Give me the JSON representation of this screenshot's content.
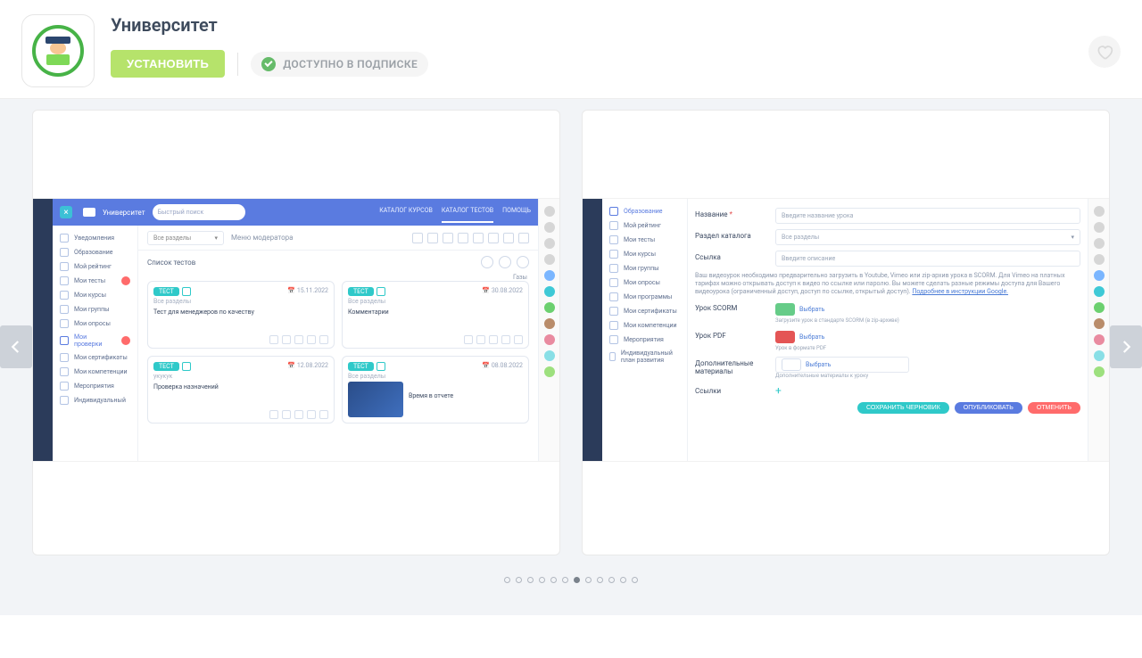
{
  "header": {
    "title": "Университет",
    "install": "УСТАНОВИТЬ",
    "subscription": "ДОСТУПНО В ПОДПИСКЕ"
  },
  "carousel": {
    "dot_count": 12,
    "active_dot": 6
  },
  "shot1": {
    "brand": "Университет",
    "search_ph": "Быстрый поиск",
    "tab_courses": "КАТАЛОГ КУРСОВ",
    "tab_tests": "КАТАЛОГ ТЕСТОВ",
    "tab_help": "ПОМОЩЬ",
    "dd_all": "Все разделы",
    "menu_mod": "Меню модератора",
    "list_title": "Список тестов",
    "group": "Газы",
    "sb": {
      "notifications": "Уведомления",
      "education": "Образование",
      "rating": "Мой рейтинг",
      "tests": "Мои тесты",
      "courses": "Мои курсы",
      "groups": "Мои группы",
      "surveys": "Мои опросы",
      "checks": "Мои проверки",
      "certs": "Мои сертификаты",
      "competences": "Мои компетенции",
      "events": "Мероприятия",
      "plan": "Индивидуальный"
    },
    "cards": [
      {
        "chip": "ТЕСТ",
        "sub": "Все разделы",
        "title": "Тест для менеджеров по качеству",
        "date": "15.11.2022"
      },
      {
        "chip": "ТЕСТ",
        "sub": "Все разделы",
        "title": "Комментарии",
        "date": "30.08.2022"
      },
      {
        "chip": "ТЕСТ",
        "sub": "укукук",
        "title": "Проверка назначений",
        "date": "12.08.2022"
      },
      {
        "chip": "ТЕСТ",
        "sub": "Все разделы",
        "title": "Время в отчете",
        "date": "08.08.2022"
      }
    ]
  },
  "shot2": {
    "sb": {
      "education": "Образование",
      "rating": "Мой рейтинг",
      "tests": "Мои тесты",
      "courses": "Мои курсы",
      "groups": "Мои группы",
      "surveys": "Мои опросы",
      "programs": "Мои программы",
      "certs": "Мои сертификаты",
      "competences": "Мои компетенции",
      "events": "Мероприятия",
      "plan": "Индивидуальный план развития"
    },
    "lbl_name": "Название",
    "ph_name": "Введите название урока",
    "lbl_section": "Раздел каталога",
    "ph_section": "Все разделы",
    "lbl_link": "Ссылка",
    "ph_link": "Введите описание",
    "note_text": "Ваш видеоурок необходимо предварительно загрузить в Youtube, Vimeo или zip-архив урока в SCORM. Для Vimeo на платных тарифах можно открывать доступ к видео по ссылке или паролю. Вы можете сделать разные режимы доступа для Вашего видеоурока (ограниченный доступ, доступ по ссылке, открытый доступ).",
    "note_link": "Подробнее в инструкции Google.",
    "lbl_scorm": "Урок SCORM",
    "hint_scorm": "Загрузите урок в стандарте SCORM (в zip-архиве)",
    "lbl_pdf": "Урок PDF",
    "hint_pdf": "Урок в формате PDF",
    "lbl_extra": "Дополнительные материалы",
    "hint_extra": "Дополнительные материалы к уроку",
    "lbl_links": "Ссылки",
    "choose": "Выбрать",
    "btn_draft": "СОХРАНИТЬ ЧЕРНОВИК",
    "btn_publish": "ОПУБЛИКОВАТЬ",
    "btn_cancel": "ОТМЕНИТЬ"
  }
}
